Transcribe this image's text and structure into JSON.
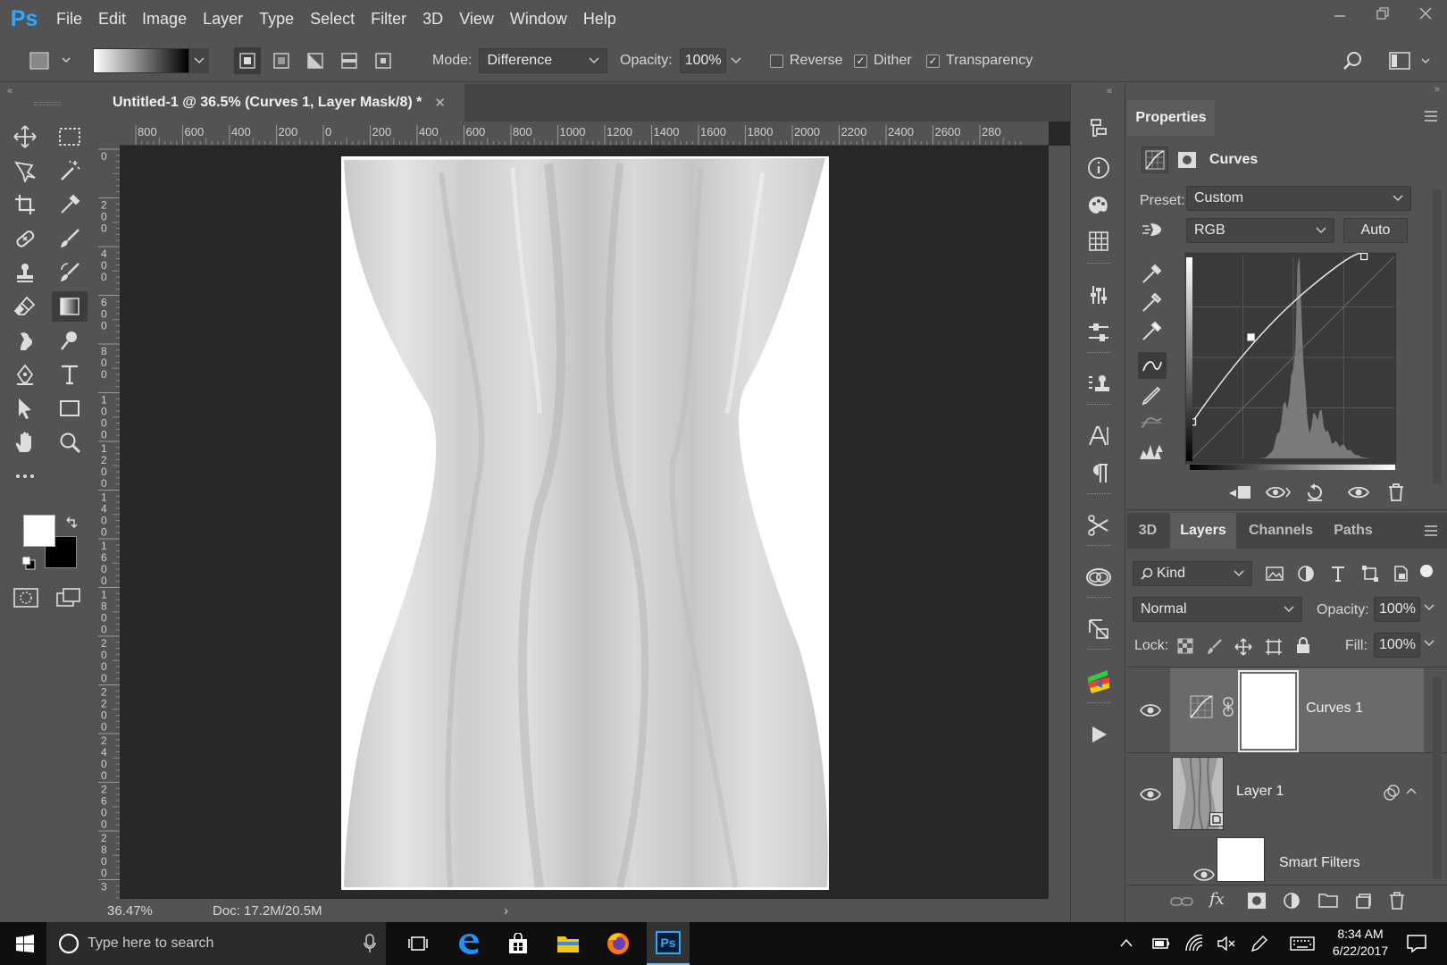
{
  "menubar": {
    "logo": "Ps",
    "items": [
      "File",
      "Edit",
      "Image",
      "Layer",
      "Type",
      "Select",
      "Filter",
      "3D",
      "View",
      "Window",
      "Help"
    ]
  },
  "optionsbar": {
    "mode_label": "Mode:",
    "mode_value": "Difference",
    "opacity_label": "Opacity:",
    "opacity_value": "100%",
    "reverse_label": "Reverse",
    "reverse_checked": false,
    "dither_label": "Dither",
    "dither_checked": true,
    "transparency_label": "Transparency",
    "transparency_checked": true
  },
  "document": {
    "tab_title": "Untitled-1 @ 36.5% (Curves 1, Layer Mask/8) *",
    "ruler_h_labels": [
      "800",
      "600",
      "400",
      "200",
      "0",
      "200",
      "400",
      "600",
      "800",
      "1000",
      "1200",
      "1400",
      "1600",
      "1800",
      "2000",
      "2200",
      "2400",
      "2600",
      "280"
    ],
    "ruler_v_labels": [
      "0",
      "2 0 0",
      "4 0 0",
      "6 0 0",
      "8 0 0",
      "1 0 0 0",
      "1 2 0 0",
      "1 4 0 0",
      "1 6 0 0",
      "1 8 0 0",
      "2 0 0 0",
      "2 2 0 0",
      "2 4 0 0",
      "2 6 0 0",
      "2 8 0 0",
      "3"
    ],
    "zoom": "36.47%",
    "doc_size": "Doc: 17.2M/20.5M"
  },
  "properties": {
    "tab": "Properties",
    "adjustment_name": "Curves",
    "preset_label": "Preset:",
    "preset_value": "Custom",
    "channel_value": "RGB",
    "auto_label": "Auto",
    "curve_points": [
      [
        0,
        0.18
      ],
      [
        0.29,
        0.6
      ],
      [
        0.85,
        1.0
      ]
    ]
  },
  "layers_panel": {
    "tabs": [
      "3D",
      "Layers",
      "Channels",
      "Paths"
    ],
    "active_tab": "Layers",
    "filter_value": "Kind",
    "blend_mode": "Normal",
    "opacity_label": "Opacity:",
    "opacity_value": "100%",
    "lock_label": "Lock:",
    "fill_label": "Fill:",
    "fill_value": "100%",
    "layers": [
      {
        "name": "Curves 1",
        "selected": true,
        "visible": true
      },
      {
        "name": "Layer 1",
        "selected": false,
        "visible": true
      },
      {
        "name": "Smart Filters",
        "selected": false,
        "visible": true
      }
    ]
  },
  "taskbar": {
    "search_placeholder": "Type here to search",
    "time": "8:34 AM",
    "date": "6/22/2017"
  },
  "colors": {
    "panel": "#535353",
    "dark": "#282828",
    "accent": "#31a8ff"
  }
}
